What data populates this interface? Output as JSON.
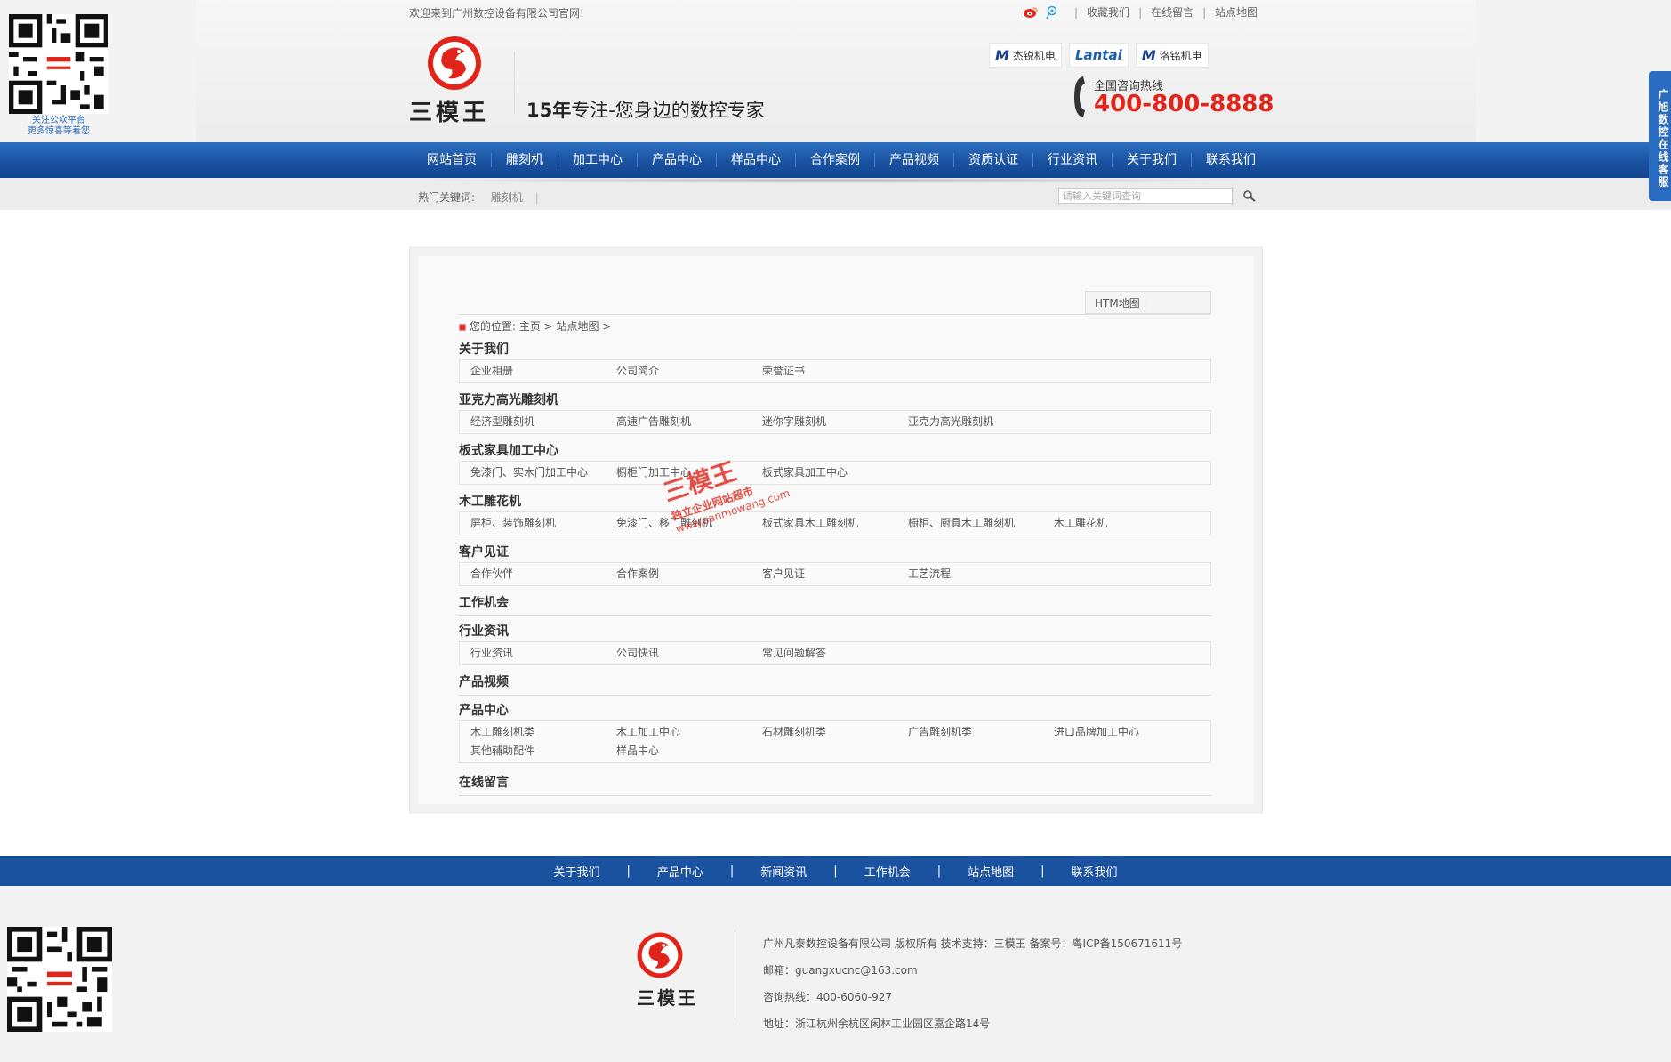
{
  "header": {
    "welcome": "欢迎来到广州数控设备有限公司官网!",
    "top_links": [
      "收藏我们",
      "在线留言",
      "站点地图"
    ],
    "qr_caption_1": "关注公众平台",
    "qr_caption_2": "更多惊喜等着您",
    "logo_text": "三模王",
    "slogan_bold": "15年",
    "slogan_rest": "专注-您身边的数控专家",
    "brands": [
      "杰锐机电",
      "Lantai",
      "洛铭机电"
    ],
    "hotline_label": "全国咨询热线",
    "hotline": "400-800-8888"
  },
  "nav": {
    "items": [
      "网站首页",
      "雕刻机",
      "加工中心",
      "产品中心",
      "样品中心",
      "合作案例",
      "产品视频",
      "资质认证",
      "行业资讯",
      "关于我们",
      "联系我们"
    ]
  },
  "subbar": {
    "hot_label": "热门关键词:",
    "hot_keyword": "雕刻机",
    "search_placeholder": "请输入关键词查询"
  },
  "service_tab": "广旭数控在线客服",
  "sitemap": {
    "tab_label": "HTM地图 |",
    "crumb": "您的位置: 主页 > 站点地图 >",
    "sections": [
      {
        "title": "关于我们",
        "items": [
          "企业相册",
          "公司简介",
          "荣誉证书"
        ]
      },
      {
        "title": "亚克力高光雕刻机",
        "items": [
          "经济型雕刻机",
          "高速广告雕刻机",
          "迷你字雕刻机",
          "亚克力高光雕刻机"
        ]
      },
      {
        "title": "板式家具加工中心",
        "items": [
          "免漆门、实木门加工中心",
          "橱柜门加工中心",
          "板式家具加工中心"
        ]
      },
      {
        "title": "木工雕花机",
        "items": [
          "屏柜、装饰雕刻机",
          "免漆门、移门雕刻机",
          "板式家具木工雕刻机",
          "橱柜、厨具木工雕刻机",
          "木工雕花机"
        ]
      },
      {
        "title": "客户见证",
        "items": [
          "合作伙伴",
          "合作案例",
          "客户见证",
          "工艺流程"
        ]
      },
      {
        "title": "工作机会",
        "items": []
      },
      {
        "title": "行业资讯",
        "items": [
          "行业资讯",
          "公司快讯",
          "常见问题解答"
        ]
      },
      {
        "title": "产品视频",
        "items": []
      },
      {
        "title": "产品中心",
        "items": [
          "木工雕刻机类",
          "木工加工中心",
          "石材雕刻机类",
          "广告雕刻机类",
          "进口品牌加工中心",
          "其他辅助配件",
          "样品中心"
        ]
      },
      {
        "title": "在线留言",
        "items": []
      }
    ]
  },
  "watermark": {
    "line1": "三模王",
    "line2": "独立企业网站超市",
    "line3": "www.sanmowang.com"
  },
  "footer": {
    "nav": [
      "关于我们",
      "产品中心",
      "新闻资讯",
      "工作机会",
      "站点地图",
      "联系我们"
    ],
    "logo_text": "三模王",
    "company": "广州凡泰数控设备有限公司  版权所有 技术支持：三模王    备案号：粤ICP备150671611号",
    "email": "邮箱：guangxucnc@163.com",
    "phone": "咨询热线：400-6060-927",
    "address": "地址：浙江杭州余杭区闲林工业园区嘉企路14号"
  },
  "colors": {
    "brand_red": "#e1251b",
    "nav_blue": "#1a52a0"
  }
}
